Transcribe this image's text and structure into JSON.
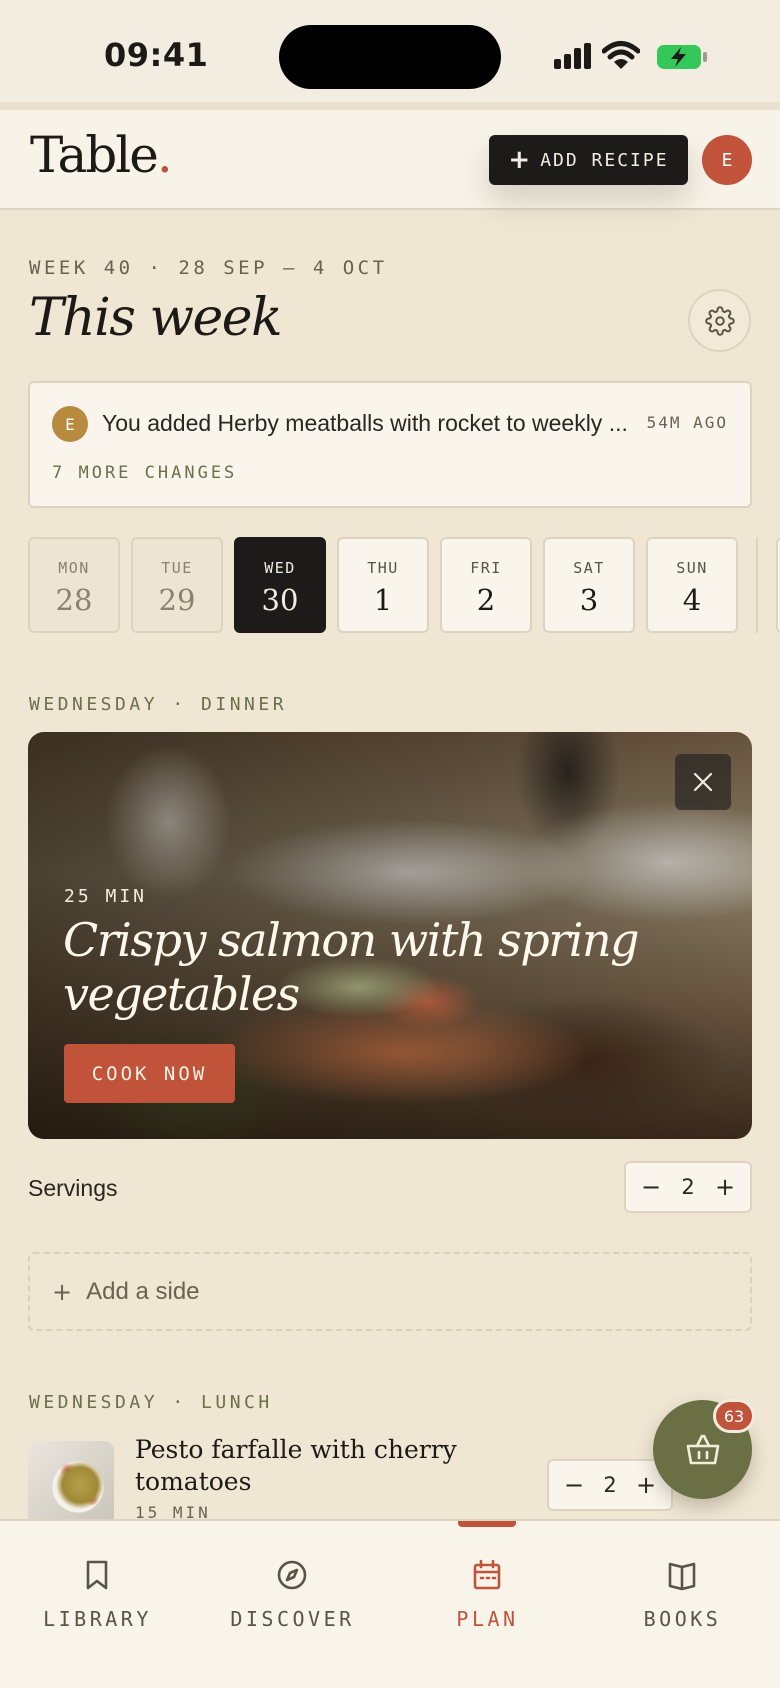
{
  "status": {
    "time": "09:41"
  },
  "header": {
    "logo": "Table",
    "logo_dot": ".",
    "add_recipe_label": "ADD RECIPE",
    "avatar_initial": "E"
  },
  "week": {
    "label": "WEEK 40 · 28 SEP – 4 OCT",
    "title": "This week"
  },
  "activity": {
    "avatar_initial": "E",
    "message": "You added Herby meatballs with rocket to weekly ...",
    "time_ago": "54M AGO",
    "more": "7 MORE CHANGES"
  },
  "days": [
    {
      "name": "MON",
      "num": "28",
      "state": "past"
    },
    {
      "name": "TUE",
      "num": "29",
      "state": "past"
    },
    {
      "name": "WED",
      "num": "30",
      "state": "active"
    },
    {
      "name": "THU",
      "num": "1",
      "state": "future"
    },
    {
      "name": "FRI",
      "num": "2",
      "state": "future"
    },
    {
      "name": "SAT",
      "num": "3",
      "state": "future"
    },
    {
      "name": "SUN",
      "num": "4",
      "state": "future"
    }
  ],
  "dinner": {
    "section_label": "WEDNESDAY · DINNER",
    "time": "25 MIN",
    "title": "Crispy salmon with spring vegetables",
    "cook_label": "COOK NOW",
    "servings_label": "Servings",
    "servings": "2",
    "add_side_label": "Add a side"
  },
  "lunch": {
    "section_label": "WEDNESDAY · LUNCH",
    "title": "Pesto farfalle with cherry tomatoes",
    "time": "15 MIN",
    "servings": "2"
  },
  "stepper": {
    "minus": "−",
    "plus": "+"
  },
  "basket": {
    "count": "63"
  },
  "nav": [
    {
      "label": "LIBRARY",
      "icon": "bookmark-icon",
      "active": false
    },
    {
      "label": "DISCOVER",
      "icon": "compass-icon",
      "active": false
    },
    {
      "label": "PLAN",
      "icon": "calendar-icon",
      "active": true
    },
    {
      "label": "BOOKS",
      "icon": "book-icon",
      "active": false
    }
  ],
  "colors": {
    "accent": "#c0533a",
    "olive": "#6b7044",
    "ink": "#1c1b19",
    "background": "#efe6d3"
  }
}
